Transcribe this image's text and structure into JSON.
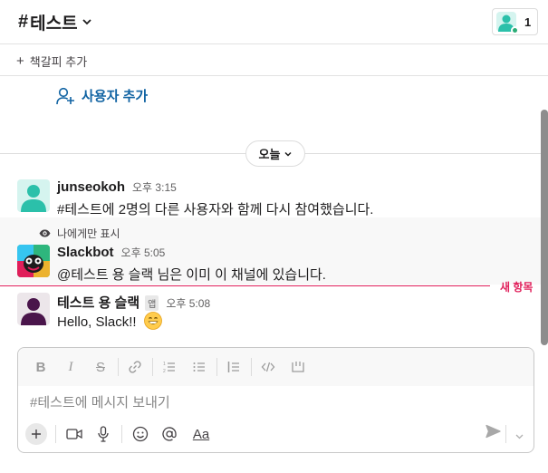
{
  "header": {
    "channel_hash": "#",
    "channel_name": "테스트",
    "member_count": "1"
  },
  "bookmarks": {
    "add_label": "책갈피 추가"
  },
  "add_user": {
    "label": "사용자 추가"
  },
  "date_divider": {
    "label": "오늘"
  },
  "messages": [
    {
      "sender": "junseokoh",
      "time": "오후 3:15",
      "text": "#테스트에 2명의 다른 사용자와 함께 다시 참여했습니다."
    },
    {
      "visibility_note": "나에게만 표시",
      "sender": "Slackbot",
      "time": "오후 5:05",
      "text": "@테스트 용 슬랙 님은 이미 이 채널에 있습니다."
    },
    {
      "sender": "테스트 용 슬랙",
      "badge": "앱",
      "time": "오후 5:08",
      "text": "Hello, Slack!!"
    }
  ],
  "new_divider": {
    "label": "새 항목"
  },
  "composer": {
    "placeholder": "#테스트에 메시지 보내기",
    "format_label": "Aa"
  },
  "colors": {
    "link": "#1264a3",
    "new_marker": "#e01e5a",
    "presence": "#2bac76"
  }
}
